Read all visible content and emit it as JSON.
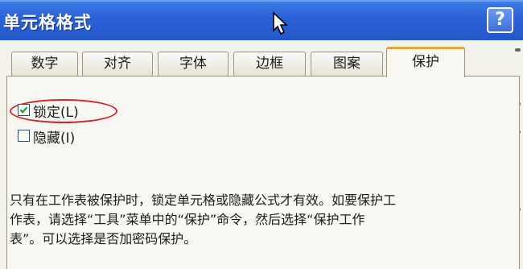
{
  "window": {
    "title": "单元格格式",
    "help_label": "?"
  },
  "tabs": [
    {
      "label": "数字",
      "active": false
    },
    {
      "label": "对齐",
      "active": false
    },
    {
      "label": "字体",
      "active": false
    },
    {
      "label": "边框",
      "active": false
    },
    {
      "label": "图案",
      "active": false
    },
    {
      "label": "保护",
      "active": true
    }
  ],
  "protection": {
    "lock": {
      "label": "锁定(L)",
      "checked": true
    },
    "hide": {
      "label": "隐藏(I)",
      "checked": false
    }
  },
  "note": {
    "line1": "只有在工作表被保护时，锁定单元格或隐藏公式才有效。如要保护工",
    "line2": "作表，请选择“工具”菜单中的“保护”命令，然后选择“保护工作",
    "line3": "表”。可以选择是否加密码保护。"
  },
  "colors": {
    "titlebar": "#2a62d6",
    "active_tab_accent": "#f0a23e",
    "annotation_circle": "#d22424"
  }
}
